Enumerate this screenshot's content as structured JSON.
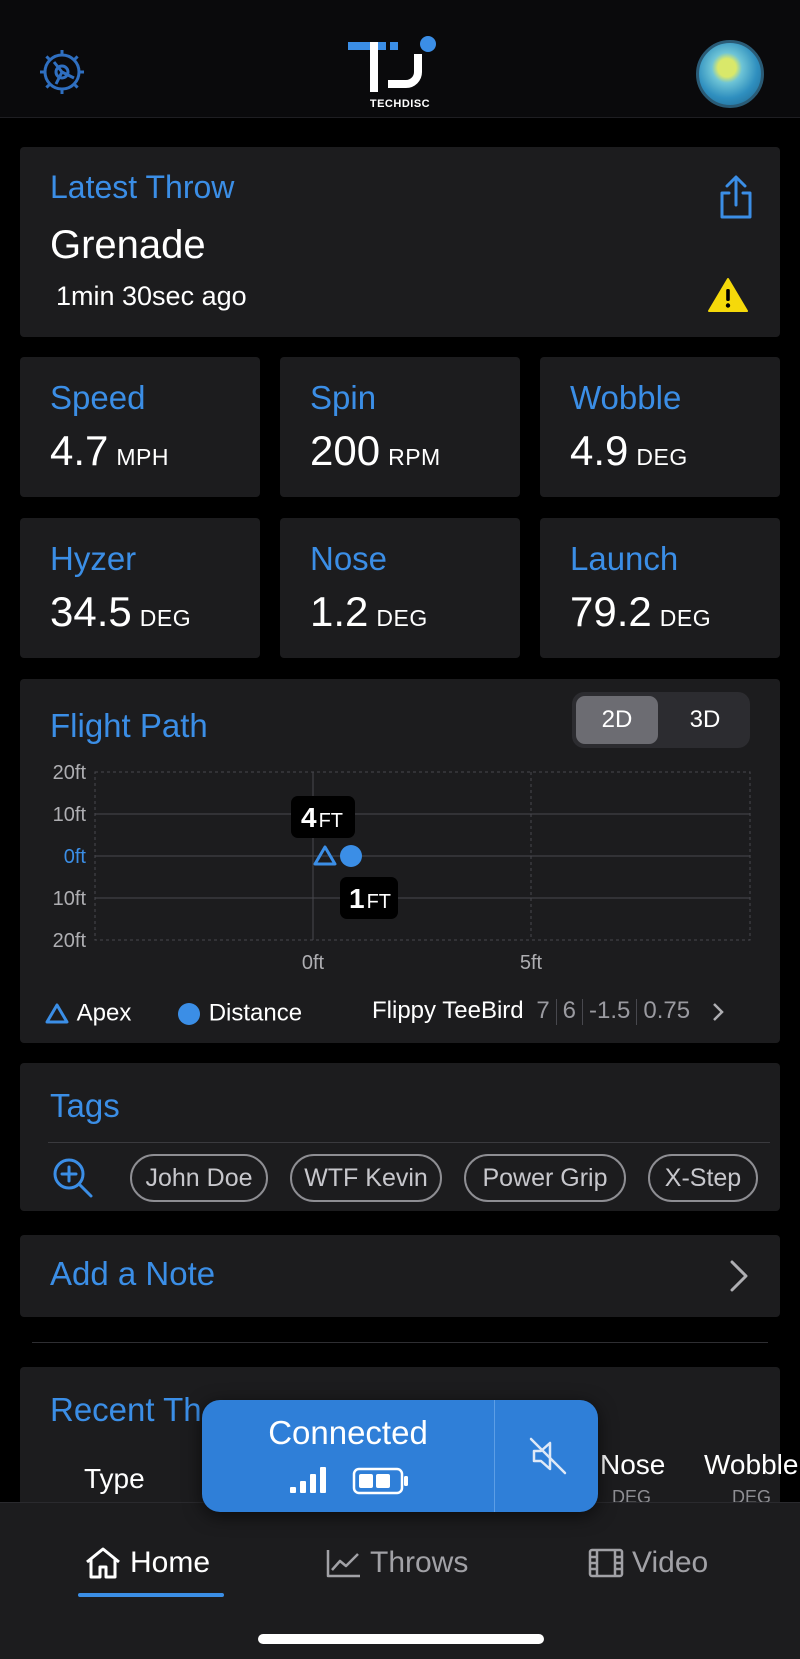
{
  "header": {
    "logo_text": "TECHDISC",
    "settings_icon": "gear-icon",
    "profile_icon": "avatar"
  },
  "latest_throw": {
    "label": "Latest Throw",
    "disc_name": "Grenade",
    "time_ago": "1min 30sec ago",
    "share_icon": "share-icon",
    "warning_icon": "warning-icon"
  },
  "metrics": [
    {
      "label": "Speed",
      "value": "4.7",
      "unit": "MPH"
    },
    {
      "label": "Spin",
      "value": "200",
      "unit": "RPM"
    },
    {
      "label": "Wobble",
      "value": "4.9",
      "unit": "DEG"
    },
    {
      "label": "Hyzer",
      "value": "34.5",
      "unit": "DEG"
    },
    {
      "label": "Nose",
      "value": "1.2",
      "unit": "DEG"
    },
    {
      "label": "Launch",
      "value": "79.2",
      "unit": "DEG"
    }
  ],
  "flight_path": {
    "title": "Flight Path",
    "toggle": {
      "option_2d": "2D",
      "option_3d": "3D",
      "selected": "2D"
    },
    "y_ticks": [
      "20ft",
      "10ft",
      "0ft",
      "10ft",
      "20ft"
    ],
    "x_ticks": [
      "0ft",
      "5ft"
    ],
    "apex_label": {
      "value": "4",
      "unit": "FT"
    },
    "distance_label": {
      "value": "1",
      "unit": "FT"
    },
    "legend": {
      "apex": "Apex",
      "distance": "Distance"
    },
    "disc": {
      "name": "Flippy TeeBird",
      "speed": "7",
      "glide": "6",
      "turn": "-1.5",
      "fade": "0.75"
    },
    "colors": {
      "accent": "#3b8ee6"
    }
  },
  "tags": {
    "title": "Tags",
    "items": [
      "John Doe",
      "WTF Kevin",
      "Power Grip",
      "X-Step"
    ]
  },
  "note": {
    "label": "Add a Note"
  },
  "recent_throws": {
    "title": "Recent Th",
    "columns": {
      "type": "Type",
      "nose": "Nose",
      "nose_unit": "DEG",
      "wobble": "Wobble",
      "wobble_unit": "DEG"
    }
  },
  "connection": {
    "status": "Connected",
    "signal_icon": "signal-icon",
    "battery_icon": "battery-icon",
    "mute_icon": "speaker-mute-icon"
  },
  "tabs": [
    {
      "label": "Home",
      "icon": "home-icon",
      "active": true
    },
    {
      "label": "Throws",
      "icon": "chart-icon",
      "active": false
    },
    {
      "label": "Video",
      "icon": "film-icon",
      "active": false
    }
  ]
}
